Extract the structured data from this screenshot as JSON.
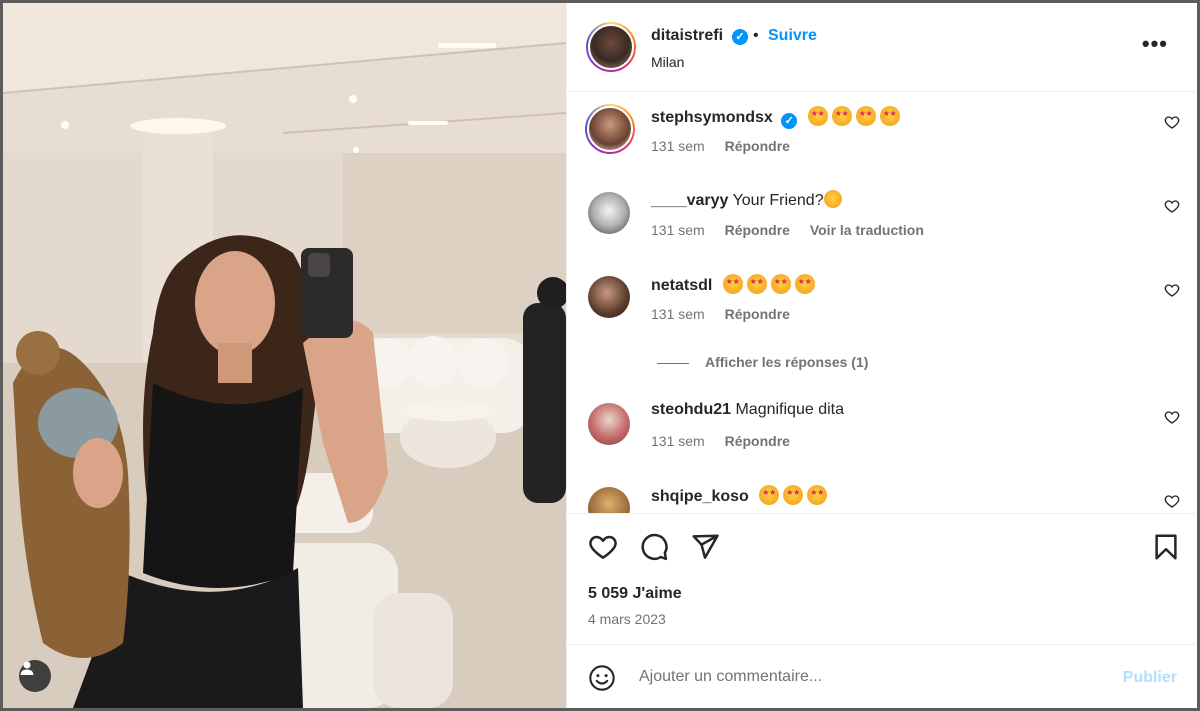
{
  "post": {
    "author": "ditaistrefi",
    "verified": true,
    "separator": "•",
    "follow_label": "Suivre",
    "location": "Milan",
    "more_label": "•••",
    "likes_text": "5 059 J'aime",
    "date": "4 mars 2023"
  },
  "comments": [
    {
      "user": "stephsymondsx",
      "verified": true,
      "text": "",
      "emoji_count": 4,
      "age": "131 sem",
      "reply_label": "Répondre",
      "translate_label": ""
    },
    {
      "user": "____varyy",
      "verified": false,
      "text": "Your Friend?",
      "emoji_count": 0,
      "age": "131 sem",
      "reply_label": "Répondre",
      "translate_label": "Voir la traduction"
    },
    {
      "user": "netatsdl",
      "verified": false,
      "text": "",
      "emoji_count": 4,
      "age": "131 sem",
      "reply_label": "Répondre",
      "translate_label": ""
    },
    {
      "user": "steohdu21",
      "verified": false,
      "text": "Magnifique dita",
      "emoji_count": 0,
      "age": "131 sem",
      "reply_label": "Répondre",
      "translate_label": ""
    },
    {
      "user": "shqipe_koso",
      "verified": false,
      "text": "",
      "emoji_count": 3,
      "age": "",
      "reply_label": "",
      "translate_label": ""
    }
  ],
  "view_replies_label": "Afficher les réponses (1)",
  "composer": {
    "placeholder": "Ajouter un commentaire...",
    "publish_label": "Publier"
  },
  "icons": {
    "like": "heart-icon",
    "comment": "comment-icon",
    "share": "send-icon",
    "save": "bookmark-icon",
    "emoji": "smiley-icon",
    "tag": "person-tag-icon"
  },
  "colors": {
    "accent": "#0095f6",
    "publish_disabled": "#b2dffc",
    "text": "#262626",
    "secondary": "#737373"
  }
}
